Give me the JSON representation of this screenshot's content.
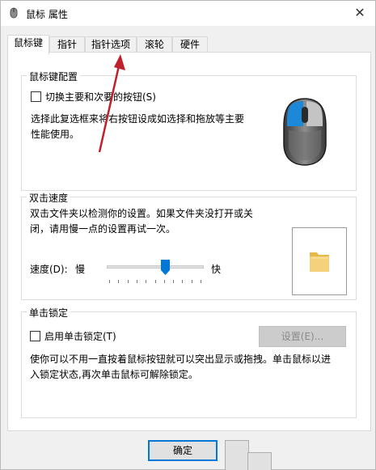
{
  "window": {
    "title": "鼠标 属性",
    "close_glyph": "✕"
  },
  "tabs": [
    {
      "label": "鼠标键",
      "active": true
    },
    {
      "label": "指针",
      "active": false
    },
    {
      "label": "指针选项",
      "active": false
    },
    {
      "label": "滚轮",
      "active": false
    },
    {
      "label": "硬件",
      "active": false
    }
  ],
  "button_config": {
    "title": "鼠标键配置",
    "checkbox_label": "切换主要和次要的按钮(S)",
    "checked": false,
    "description_line1": "选择此复选框来将右按钮设成如选择和拖放等主要",
    "description_line2": "性能使用。",
    "accent_color": "#1e88d8"
  },
  "double_click": {
    "title": "双击速度",
    "description_line1": "双击文件夹以检测你的设置。如果文件夹没打开或关",
    "description_line2": "闭，请用慢一点的设置再试一次。",
    "speed_label": "速度(D):",
    "slow_label": "慢",
    "fast_label": "快",
    "speed_level_fraction": 0.6,
    "tick_count": 11
  },
  "click_lock": {
    "title": "单击锁定",
    "checkbox_label": "启用单击锁定(T)",
    "checked": false,
    "settings_button": "设置(E)...",
    "description_line1": "使你可以不用一直按着鼠标按钮就可以突出显示或拖拽。单击鼠标以进",
    "description_line2": "入锁定状态,再次单击鼠标可解除锁定。"
  },
  "footer": {
    "ok_label": "确定"
  },
  "annotation": {
    "arrow_color": "#c0202a"
  }
}
